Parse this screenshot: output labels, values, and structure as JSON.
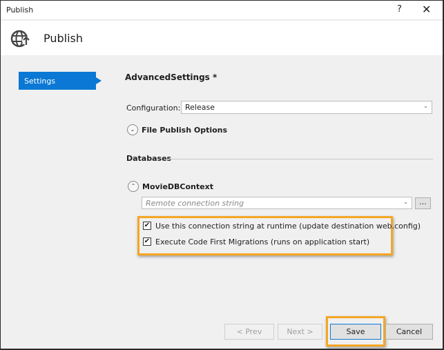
{
  "window": {
    "title": "Publish",
    "help": "?",
    "close": "✕"
  },
  "header": {
    "title": "Publish",
    "icon": "globe-upload-icon"
  },
  "sidebar": {
    "items": [
      {
        "label": "Settings",
        "selected": true
      }
    ]
  },
  "main": {
    "title": "AdvancedSettings *",
    "configuration_label": "Configuration:",
    "configuration_value": "Release",
    "file_publish_options": "File Publish Options",
    "databases_label": "Databases",
    "db_context": "MovieDBContext",
    "connection_placeholder": "Remote connection string",
    "browse_label": "...",
    "use_connection_string": {
      "label": "Use this connection string at runtime (update destination web.config)",
      "checked": true
    },
    "execute_migrations": {
      "label": "Execute Code First Migrations (runs on application start)",
      "checked": true
    }
  },
  "footer": {
    "prev": "< Prev",
    "next": "Next >",
    "save": "Save",
    "cancel": "Cancel"
  },
  "colors": {
    "accent": "#0a78d4",
    "highlight": "#f5a623"
  }
}
